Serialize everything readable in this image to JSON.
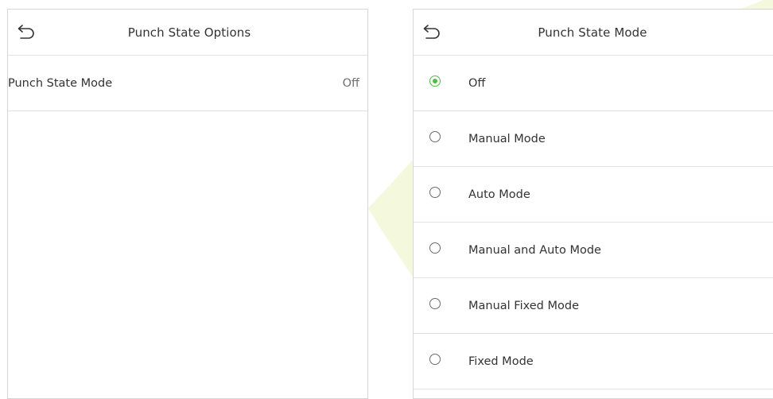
{
  "colors": {
    "accent_green": "#55b84a",
    "border": "#d6d6d6",
    "divider": "#e2e2e2",
    "text": "#333333",
    "muted_text": "#6f6f6f",
    "watermark": "#f2f8d8"
  },
  "left_panel": {
    "back_icon": "back-arrow-icon",
    "title": "Punch State Options",
    "items": [
      {
        "label": "Punch State Mode",
        "value": "Off"
      }
    ]
  },
  "right_panel": {
    "back_icon": "back-arrow-icon",
    "title": "Punch State Mode",
    "selected_index": 0,
    "options": [
      {
        "label": "Off"
      },
      {
        "label": "Manual Mode"
      },
      {
        "label": "Auto Mode"
      },
      {
        "label": "Manual and Auto Mode"
      },
      {
        "label": "Manual Fixed Mode"
      },
      {
        "label": "Fixed Mode"
      }
    ]
  }
}
